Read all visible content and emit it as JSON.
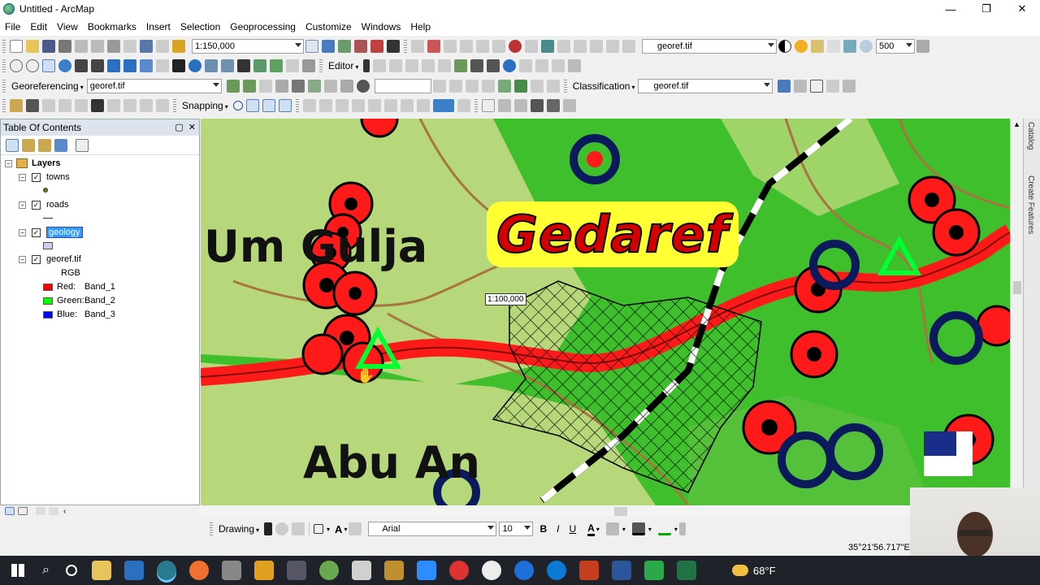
{
  "window": {
    "title": "Untitled - ArcMap",
    "minimize": "—",
    "restore": "❐",
    "close": "✕"
  },
  "menu": [
    "File",
    "Edit",
    "View",
    "Bookmarks",
    "Insert",
    "Selection",
    "Geoprocessing",
    "Customize",
    "Windows",
    "Help"
  ],
  "toolbar1": {
    "scale": "1:150,000",
    "layer_select": "georef.tif",
    "brightness_value": "500"
  },
  "toolbar2": {
    "editor_label": "Editor",
    "editor_arrow": "▾"
  },
  "toolbar3": {
    "georef_label": "Georeferencing",
    "georef_layer": "georef.tif",
    "classification_label": "Classification",
    "classification_layer": "georef.tif"
  },
  "toolbar4": {
    "snapping_label": "Snapping"
  },
  "toc": {
    "title": "Table Of Contents",
    "root": "Layers",
    "layers": [
      {
        "name": "towns",
        "checked": true
      },
      {
        "name": "roads",
        "checked": true
      },
      {
        "name": "geology",
        "checked": true,
        "selected": true
      },
      {
        "name": "georef.tif",
        "checked": true
      }
    ],
    "raster": {
      "mode": "RGB",
      "bands": [
        {
          "label": "Red:",
          "band": "Band_1",
          "color": "#ff0000"
        },
        {
          "label": "Green:",
          "band": "Band_2",
          "color": "#00ff00"
        },
        {
          "label": "Blue:",
          "band": "Band_3",
          "color": "#0000ff"
        }
      ]
    },
    "geology_swatch_color": "#c8d0ee"
  },
  "map": {
    "labels": {
      "gedaref": "Gedaref",
      "um_gulja": "Um Gulja",
      "abu_an": "Abu An"
    },
    "scale_tip": "1:100,000"
  },
  "right_dock": {
    "catalog": "Catalog",
    "create_features": "Create Features"
  },
  "drawing": {
    "label": "Drawing",
    "font": "Arial",
    "font_size": "10",
    "bold": "B",
    "italic": "I",
    "underline": "U",
    "font_color": "A"
  },
  "status": {
    "coordinates": "35°21'56.717\"E"
  },
  "taskbar": {
    "temperature": "68°F"
  },
  "colors": {
    "map_green": "#3fbf2c",
    "map_lightgreen": "#b7d87a",
    "road_red": "#ff1a1a",
    "label_yellow": "#ffff33",
    "selected_bg": "#3399ff"
  }
}
